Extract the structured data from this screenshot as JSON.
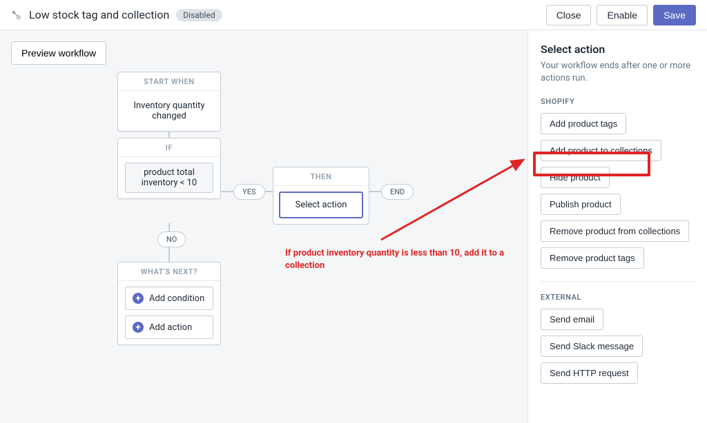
{
  "header": {
    "title": "Low stock tag and collection",
    "status": "Disabled",
    "close": "Close",
    "enable": "Enable",
    "save": "Save"
  },
  "canvas": {
    "preview": "Preview workflow",
    "start_header": "START WHEN",
    "start_text": "Inventory quantity changed",
    "if_header": "IF",
    "if_condition": "product total inventory < 10",
    "yes": "YES",
    "no": "NO",
    "then_header": "THEN",
    "then_action": "Select action",
    "end": "END",
    "next_header": "WHAT'S NEXT?",
    "add_condition": "Add condition",
    "add_action": "Add action",
    "annotation": "If product inventory quantity is less than 10, add it to a collection"
  },
  "panel": {
    "title": "Select action",
    "subtitle": "Your workflow ends after one or more actions run.",
    "shopify_label": "SHOPIFY",
    "shopify_actions": {
      "0": "Add product tags",
      "1": "Add product to collections",
      "2": "Hide product",
      "3": "Publish product",
      "4": "Remove product from collections",
      "5": "Remove product tags"
    },
    "external_label": "EXTERNAL",
    "external_actions": {
      "0": "Send email",
      "1": "Send Slack message",
      "2": "Send HTTP request"
    }
  }
}
